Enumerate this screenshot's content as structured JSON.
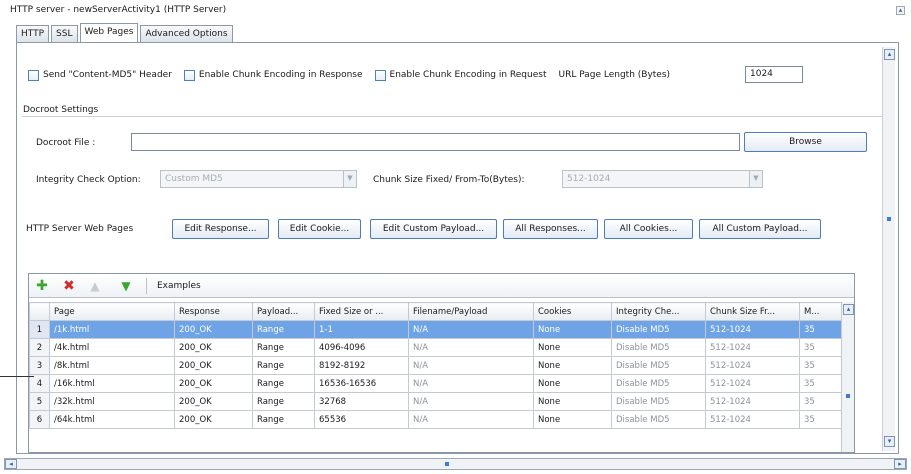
{
  "window": {
    "title": "HTTP server - newServerActivity1 (HTTP Server)",
    "collapse_glyph": "▴"
  },
  "tabs": [
    {
      "label": "HTTP",
      "active": false
    },
    {
      "label": "SSL",
      "active": false
    },
    {
      "label": "Web Pages",
      "active": true
    },
    {
      "label": "Advanced Options",
      "active": false
    }
  ],
  "options": {
    "content_md5": "Send \"Content-MD5\" Header",
    "chunk_response": "Enable Chunk Encoding in Response",
    "chunk_request": "Enable Chunk Encoding in Request",
    "url_length_label": "URL Page Length (Bytes)",
    "url_length_value": "1024"
  },
  "docroot": {
    "section_title": "Docroot Settings",
    "file_label": "Docroot File :",
    "file_value": "",
    "browse_label": "Browse",
    "integrity_label": "Integrity Check Option:",
    "integrity_value": "Custom MD5",
    "chunk_label": "Chunk Size Fixed/ From-To(Bytes):",
    "chunk_value": "512-1024"
  },
  "web_pages": {
    "label": "HTTP Server Web Pages",
    "buttons": [
      "Edit Response...",
      "Edit Cookie...",
      "Edit Custom Payload...",
      "All Responses...",
      "All Cookies...",
      "All Custom Payload..."
    ]
  },
  "toolbar": {
    "add_glyph": "✚",
    "delete_glyph": "✖",
    "up_glyph": "▲",
    "down_glyph": "▼",
    "examples_label": "Examples"
  },
  "scroll_glyphs": {
    "up": "▴",
    "down": "▾",
    "left": "◂",
    "right": "▸"
  },
  "table": {
    "headers": [
      "",
      "Page",
      "Response",
      "Payload...",
      "Fixed Size or ...",
      "Filename/Payload",
      "Cookies",
      "Integrity Che...",
      "Chunk Size Fr...",
      "M..."
    ],
    "rows": [
      [
        "1",
        "/1k.html",
        "200_OK",
        "Range",
        "1-1",
        "N/A",
        "None",
        "Disable MD5",
        "512-1024",
        "35"
      ],
      [
        "2",
        "/4k.html",
        "200_OK",
        "Range",
        "4096-4096",
        "N/A",
        "None",
        "Disable MD5",
        "512-1024",
        "35"
      ],
      [
        "3",
        "/8k.html",
        "200_OK",
        "Range",
        "8192-8192",
        "N/A",
        "None",
        "Disable MD5",
        "512-1024",
        "35"
      ],
      [
        "4",
        "/16k.html",
        "200_OK",
        "Range",
        "16536-16536",
        "N/A",
        "None",
        "Disable MD5",
        "512-1024",
        "35"
      ],
      [
        "5",
        "/32k.html",
        "200_OK",
        "Range",
        "32768",
        "N/A",
        "None",
        "Disable MD5",
        "512-1024",
        "35"
      ],
      [
        "6",
        "/64k.html",
        "200_OK",
        "Range",
        "65536",
        "N/A",
        "None",
        "Disable MD5",
        "512-1024",
        "35"
      ]
    ],
    "selected_row": 0
  },
  "colors": {
    "selection": "#6ea3e6",
    "accent_border": "#4f7bb8",
    "add_green": "#3aa52f",
    "delete_red": "#d22c2c"
  }
}
